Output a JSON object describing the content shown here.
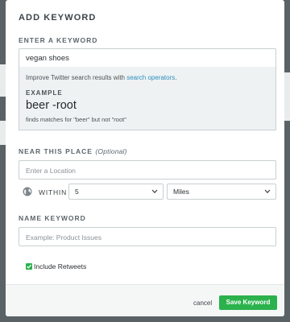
{
  "dialog": {
    "title": "ADD KEYWORD",
    "keyword_section_label": "ENTER A KEYWORD",
    "keyword_value": "vegan shoes",
    "hint": {
      "text_prefix": "Improve Twitter search results with ",
      "link_text": "search operators",
      "text_suffix": ".",
      "example_label": "EXAMPLE",
      "example_query": "beer -root",
      "example_desc": "finds matches for \"beer\" but not \"root\""
    },
    "location_section_label": "NEAR THIS PLACE",
    "location_optional": "(Optional)",
    "location_placeholder": "Enter a Location",
    "globe_icon": "globe-icon",
    "within_label": "WITHIN",
    "distance_value": "5",
    "unit_value": "Miles",
    "name_section_label": "NAME KEYWORD",
    "name_placeholder": "Example: Product Issues",
    "include_retweets_label": "Include Retweets",
    "include_retweets_checked": true,
    "cancel_label": "cancel",
    "save_label": "Save Keyword"
  },
  "colors": {
    "accent_green": "#2bb24c",
    "link_blue": "#2b8fbd",
    "overlay": "#5b6266"
  }
}
